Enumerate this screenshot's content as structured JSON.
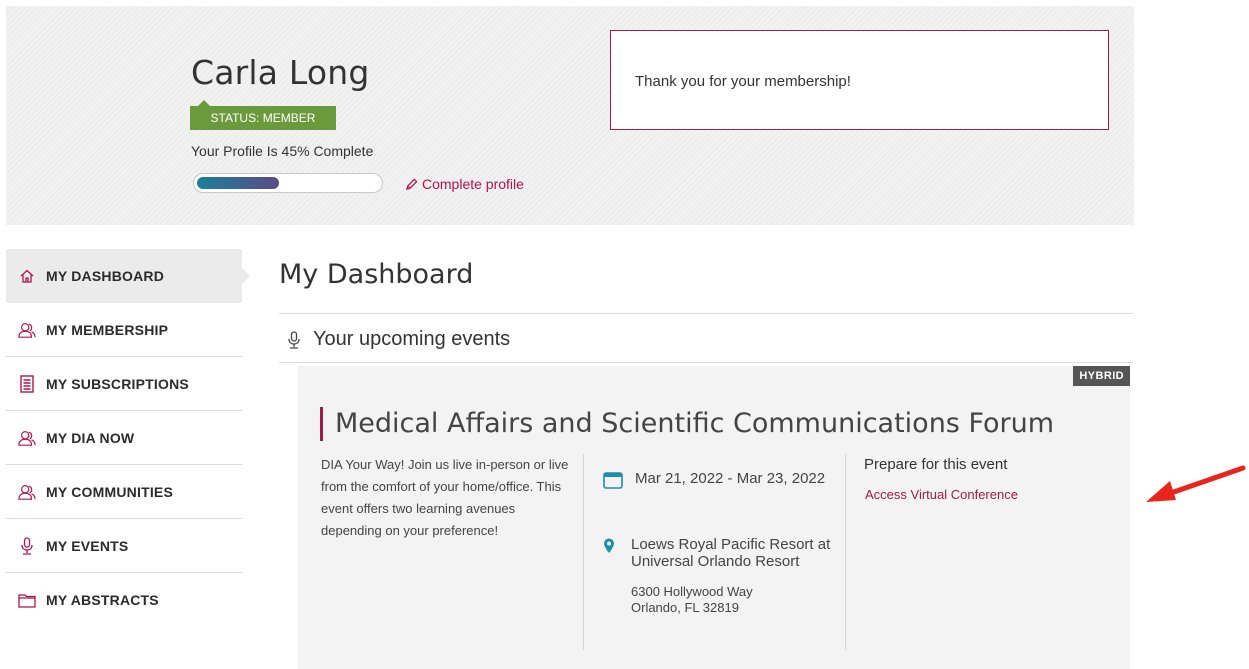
{
  "profile": {
    "name": "Carla Long",
    "status": "STATUS: MEMBER",
    "completion_text": "Your Profile Is 45% Complete",
    "completion_fraction": 0.45,
    "complete_link": "Complete profile"
  },
  "notice": {
    "text": "Thank you for your membership!"
  },
  "sidebar": {
    "items": [
      {
        "label": "MY DASHBOARD",
        "icon": "home-icon",
        "active": true
      },
      {
        "label": "MY MEMBERSHIP",
        "icon": "members-icon",
        "active": false
      },
      {
        "label": "MY SUBSCRIPTIONS",
        "icon": "newspaper-icon",
        "active": false
      },
      {
        "label": "MY DIA NOW",
        "icon": "members-icon",
        "active": false
      },
      {
        "label": "MY COMMUNITIES",
        "icon": "members-icon",
        "active": false
      },
      {
        "label": "MY EVENTS",
        "icon": "microphone-icon",
        "active": false
      },
      {
        "label": "MY ABSTRACTS",
        "icon": "folder-icon",
        "active": false
      }
    ]
  },
  "main": {
    "title": "My Dashboard",
    "section_title": "Your upcoming events",
    "event": {
      "badge": "HYBRID",
      "title": "Medical Affairs and Scientific Communications Forum",
      "description": "DIA Your Way! Join us live in-person or live from the comfort of your home/office. This event offers two learning avenues depending on your preference!",
      "date": "Mar 21, 2022 - Mar 23, 2022",
      "location_name": "Loews Royal Pacific Resort at Universal Orlando Resort",
      "address_line1": "6300 Hollywood Way",
      "address_line2": "Orlando, FL 32819",
      "prepare_heading": "Prepare for this event",
      "access_link": "Access Virtual Conference"
    }
  },
  "colors": {
    "accent": "#a11a4a",
    "status_green": "#6a9a3b",
    "teal_icon": "#1c8fa8",
    "annotation_red": "#e8241c"
  }
}
